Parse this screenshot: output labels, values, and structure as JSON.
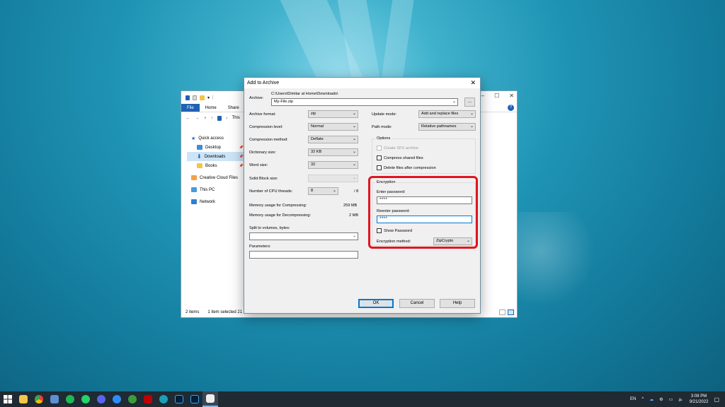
{
  "explorer": {
    "ribbon_tabs": [
      "File",
      "Home",
      "Share"
    ],
    "address_text": "This",
    "nav_items": [
      {
        "label": "Quick access",
        "icon": "star-icon"
      },
      {
        "label": "Desktop",
        "icon": "desktop-icon"
      },
      {
        "label": "Downloads",
        "icon": "download-icon"
      },
      {
        "label": "Books",
        "icon": "folder-icon"
      },
      {
        "label": "Creative Cloud Files",
        "icon": "cloud-folder-icon"
      },
      {
        "label": "This PC",
        "icon": "pc-icon"
      },
      {
        "label": "Network",
        "icon": "network-icon"
      }
    ],
    "status_items": "2 items",
    "status_selected": "1 item selected  21 KB"
  },
  "dialog": {
    "title": "Add to Archive",
    "archive_label": "Archive:",
    "archive_path": "C:\\Users\\Dimitar at Home\\Downloads\\",
    "archive_name": "My-File.zip",
    "browse_label": "...",
    "left": {
      "archive_format_label": "Archive format:",
      "archive_format": "zip",
      "compression_level_label": "Compression level:",
      "compression_level": "Normal",
      "compression_method_label": "Compression method:",
      "compression_method": "Deflate",
      "dictionary_size_label": "Dictionary size:",
      "dictionary_size": "32 KB",
      "word_size_label": "Word size:",
      "word_size": "32",
      "solid_block_label": "Solid Block size:",
      "solid_block": "",
      "cpu_threads_label": "Number of CPU threads:",
      "cpu_threads": "8",
      "cpu_threads_max": "/ 8",
      "mem_compress_label": "Memory usage for Compressing:",
      "mem_compress": "259 MB",
      "mem_decompress_label": "Memory usage for Decompressing:",
      "mem_decompress": "2 MB",
      "split_label": "Split to volumes, bytes:",
      "split_value": "",
      "params_label": "Parameters:",
      "params_value": ""
    },
    "right": {
      "update_mode_label": "Update mode:",
      "update_mode": "Add and replace files",
      "path_mode_label": "Path mode:",
      "path_mode": "Relative pathnames",
      "options_title": "Options",
      "opt_sfx": "Create SFX archive",
      "opt_shared": "Compress shared files",
      "opt_delete": "Delete files after compression",
      "encryption_title": "Encryption",
      "enter_pw_label": "Enter password:",
      "enter_pw": "****",
      "reenter_pw_label": "Reenter password:",
      "reenter_pw": "****",
      "show_pw": "Show Password",
      "enc_method_label": "Encryption method:",
      "enc_method": "ZipCrypto"
    },
    "buttons": {
      "ok": "OK",
      "cancel": "Cancel",
      "help": "Help"
    }
  },
  "taskbar": {
    "language": "EN",
    "time": "3:08 PM",
    "date": "9/21/2022"
  },
  "colors": {
    "highlight": "#e0141f",
    "file_tab": "#1e62b5",
    "taskbar": "#1f2a33"
  }
}
